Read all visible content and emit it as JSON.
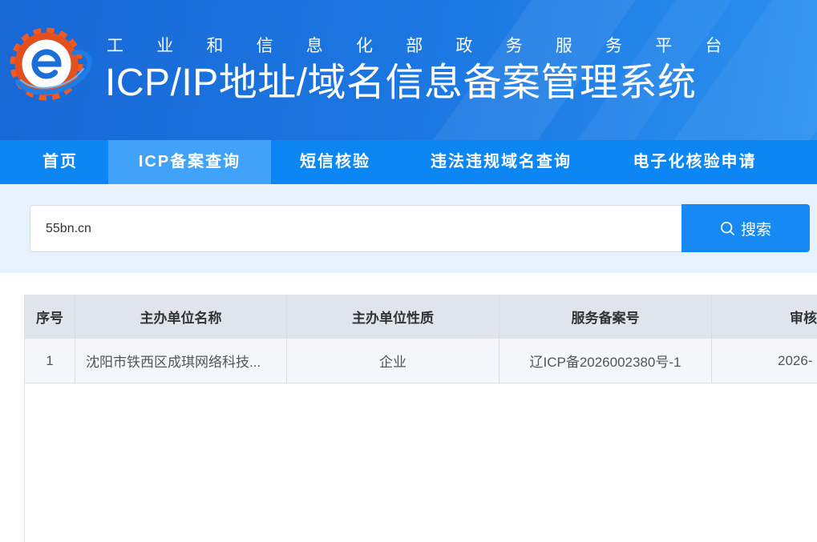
{
  "theme": {
    "header_from": "#1868d6",
    "header_to": "#2b91f0",
    "nav_bg": "#0b86f2",
    "nav_active_bg": "#41a2f9",
    "band_bg": "#e7f2fd",
    "button_bg": "#1689f4",
    "table_header_bg": "#dfe4ed",
    "table_row_bg": "#f4f6f9"
  },
  "header": {
    "logo_icon": "gear-e-logo-icon",
    "subtitle": "工业和信息化部政务服务平台",
    "title": "ICP/IP地址/域名信息备案管理系统"
  },
  "nav": {
    "items": [
      {
        "label": "首页",
        "active": false
      },
      {
        "label": "ICP备案查询",
        "active": true
      },
      {
        "label": "短信核验",
        "active": false
      },
      {
        "label": "违法违规域名查询",
        "active": false
      },
      {
        "label": "电子化核验申请",
        "active": false
      }
    ]
  },
  "search": {
    "value": "55bn.cn",
    "button_label": "搜索",
    "button_icon": "search-icon"
  },
  "table": {
    "columns": [
      "序号",
      "主办单位名称",
      "主办单位性质",
      "服务备案号",
      "审核"
    ],
    "rows": [
      [
        "1",
        "沈阳市铁西区成琪网络科技...",
        "企业",
        "辽ICP备2026002380号-1",
        "2026-"
      ]
    ]
  }
}
